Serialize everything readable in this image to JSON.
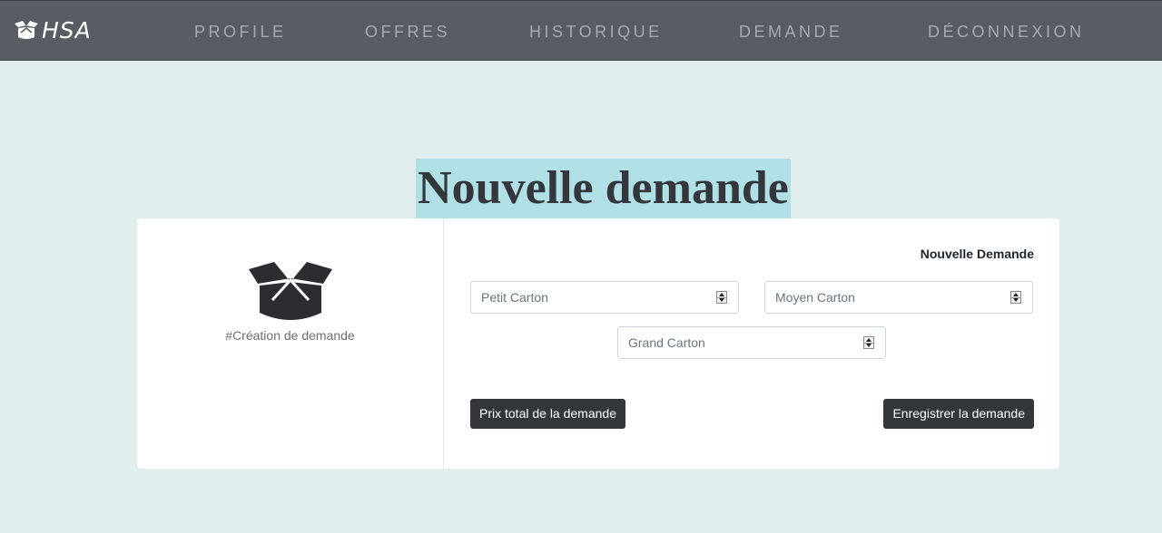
{
  "navbar": {
    "brand": "HSA",
    "brand_icon": "open-box-icon",
    "items": [
      {
        "label": "PROFILE"
      },
      {
        "label": "OFFRES"
      },
      {
        "label": "HISTORIQUE"
      },
      {
        "label": "DEMANDE"
      },
      {
        "label": "DÉCONNEXION"
      }
    ]
  },
  "page": {
    "title": "Nouvelle demande"
  },
  "card": {
    "left": {
      "icon": "open-box-icon",
      "caption": "#Création de demande"
    },
    "right": {
      "title": "Nouvelle Demande",
      "fields": [
        {
          "placeholder": "Petit Carton",
          "value": ""
        },
        {
          "placeholder": "Moyen Carton",
          "value": ""
        },
        {
          "placeholder": "Grand Carton",
          "value": ""
        }
      ],
      "total_button": "Prix total de la demande",
      "save_button": "Enregistrer la demande"
    }
  },
  "colors": {
    "navbar_bg": "#585d63",
    "page_bg": "#e0eeee",
    "title_highlight": "#b0e0e6",
    "button_bg": "#33373c"
  }
}
